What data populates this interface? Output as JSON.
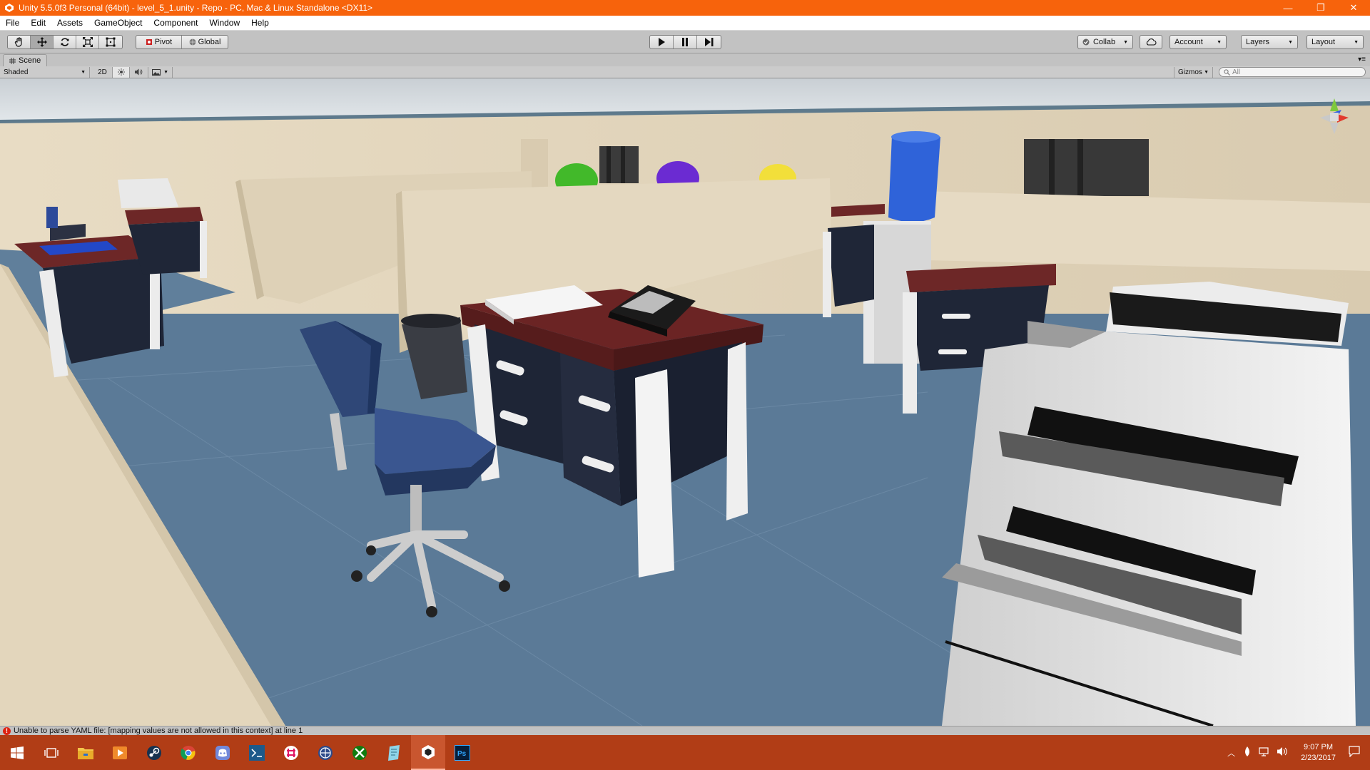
{
  "window": {
    "title": "Unity 5.5.0f3 Personal (64bit) - level_5_1.unity - Repo - PC, Mac & Linux Standalone <DX11>",
    "minimize": "—",
    "maximize": "❐",
    "close": "✕"
  },
  "menu": [
    "File",
    "Edit",
    "Assets",
    "GameObject",
    "Component",
    "Window",
    "Help"
  ],
  "toolbar": {
    "pivot": "Pivot",
    "global": "Global",
    "collab": "Collab",
    "account": "Account",
    "layers": "Layers",
    "layout": "Layout"
  },
  "scene": {
    "tab_label": "Scene",
    "shading_mode": "Shaded",
    "mode_2d": "2D",
    "gizmos": "Gizmos",
    "search_placeholder": "All"
  },
  "status": {
    "error_message": "Unable to parse YAML file: [mapping values are not allowed in this context] at line 1"
  },
  "taskbar": {
    "time": "9:07 PM",
    "date": "2/23/2017"
  },
  "colors": {
    "title_bar": "#f7630c",
    "taskbar": "#b13d16",
    "editor_chrome": "#c2c2c2",
    "floor": "#5b7a97",
    "desk_top": "#6b2424",
    "desk_drawers": "#1e2536",
    "chair": "#2f4777",
    "partition": "#e2d5bd"
  }
}
